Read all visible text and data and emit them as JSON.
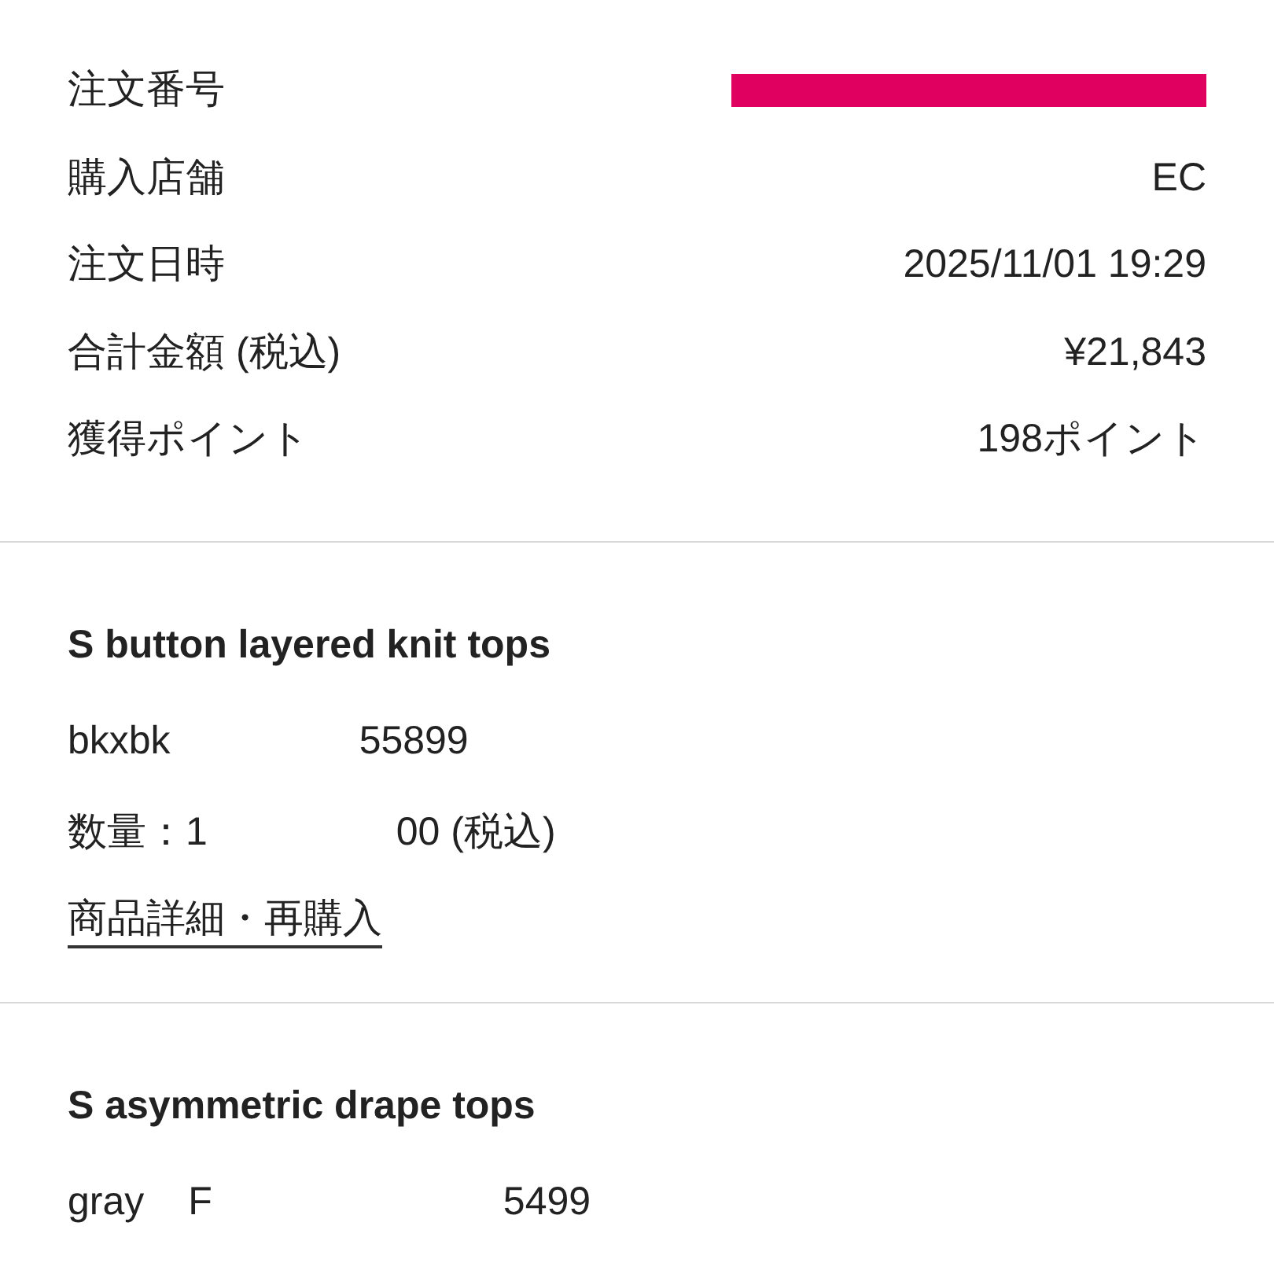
{
  "order_summary": [
    {
      "label": "注文番号",
      "redacted": true
    },
    {
      "label": "購入店舗",
      "value": "EC"
    },
    {
      "label": "注文日時",
      "value": "2025/11/01 19:29"
    },
    {
      "label": "合計金額 (税込)",
      "value": "¥21,843"
    },
    {
      "label": "獲得ポイント",
      "value": "198ポイント"
    }
  ],
  "products": [
    {
      "name": "S button layered knit tops",
      "lines": [
        [
          "bkxbk",
          "55899"
        ],
        [
          "数量：1",
          "00 (税込)"
        ]
      ],
      "link": "商品詳細・再購入"
    },
    {
      "name": "S asymmetric drape tops",
      "lines": [
        [
          "gray",
          "F",
          "5499"
        ]
      ]
    }
  ]
}
